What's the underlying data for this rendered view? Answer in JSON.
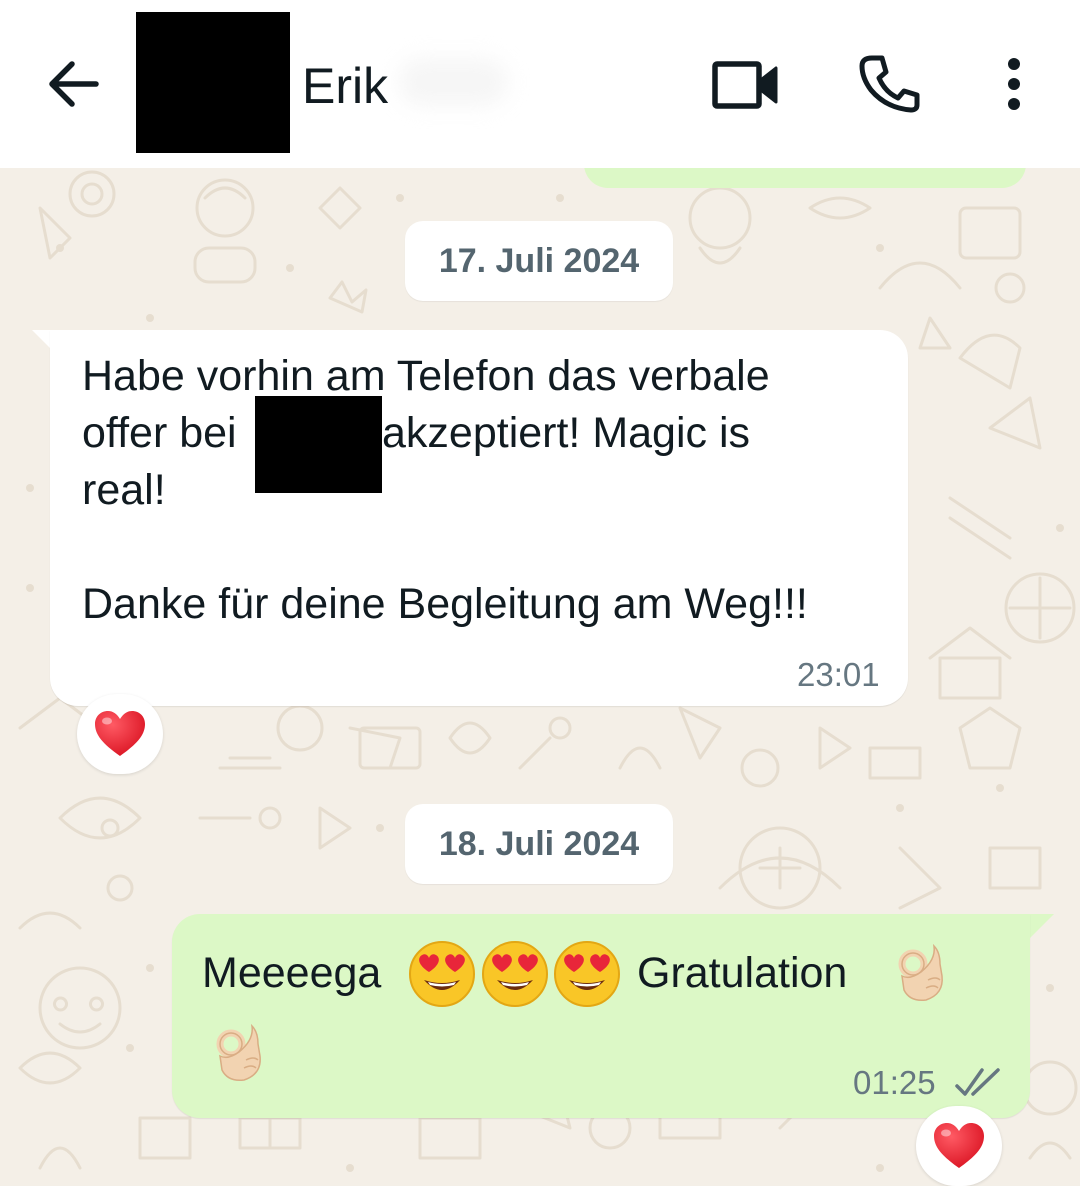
{
  "header": {
    "contact_name": "Erik"
  },
  "messages": [
    {
      "date": "17. Juli 2024",
      "direction": "incoming",
      "lines": [
        "Habe vorhin am Telefon das verbale",
        "offer bei",
        "akzeptiert! Magic is",
        "real!",
        "Danke für deine Begleitung am Weg!!!"
      ],
      "time": "23:01",
      "reaction": "heart"
    },
    {
      "date": "18. Juli 2024",
      "direction": "outgoing",
      "text_start": "Meeeega",
      "text_end": "Gratulation",
      "emojis": [
        "heart-eyes",
        "heart-eyes",
        "heart-eyes",
        "ok-hand",
        "ok-hand"
      ],
      "time": "01:25",
      "status": "read",
      "reaction": "heart"
    }
  ],
  "colors": {
    "wallpaper": "#f4efe7",
    "incoming_bubble": "#ffffff",
    "outgoing_bubble": "#dcf8c6",
    "timestamp": "#667781",
    "heart": "#e0202e"
  }
}
